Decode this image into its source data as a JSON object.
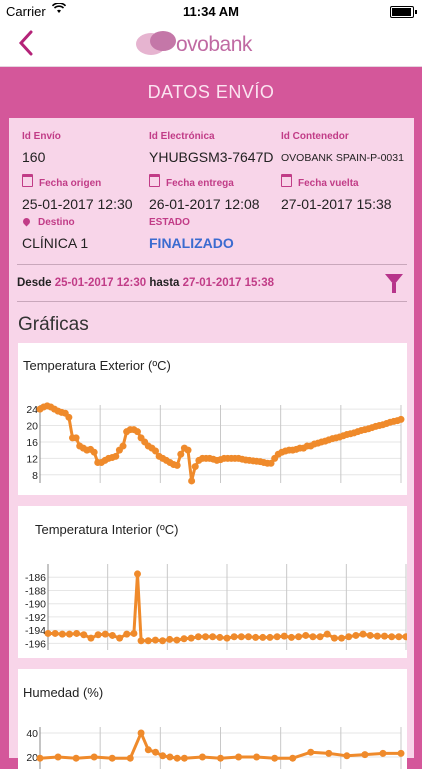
{
  "status_bar": {
    "carrier": "Carrier",
    "wifi_icon": "wifi-icon",
    "time": "11:34 AM",
    "battery_icon": "battery-icon"
  },
  "nav": {
    "back_icon": "chevron-left-icon",
    "back_glyph": "‹",
    "logo_text": "ovobank"
  },
  "page_title": "DATOS ENVÍO",
  "shipment": {
    "id_envio": {
      "label": "Id Envío",
      "value": "160"
    },
    "id_electronica": {
      "label": "Id Electrónica",
      "value": "YHUBGSM3-7647D"
    },
    "id_contenedor": {
      "label": "Id Contenedor",
      "value": "OVOBANK SPAIN-P-0031"
    },
    "fecha_origen": {
      "label": "Fecha origen",
      "value": "25-01-2017 12:30"
    },
    "fecha_entrega": {
      "label": "Fecha entrega",
      "value": "26-01-2017 12:08"
    },
    "fecha_vuelta": {
      "label": "Fecha vuelta",
      "value": "27-01-2017 15:38"
    },
    "destino": {
      "label": "Destino",
      "value": "CLÍNICA 1"
    },
    "estado": {
      "label": "ESTADO",
      "value": "FINALIZADO"
    }
  },
  "range": {
    "desde_label": "Desde",
    "desde": "25-01-2017 12:30",
    "hasta_label": "hasta",
    "hasta": "27-01-2017 15:38",
    "filter_icon": "filter-icon"
  },
  "graficas_title": "Gráficas",
  "colors": {
    "brand": "#d4579a",
    "accent": "#c13c87",
    "status": "#3b6bd0",
    "series": "#ef8a2b"
  },
  "chart_data": [
    {
      "type": "scatter",
      "title": "Temperatura Exterior (ºC)",
      "ylim": [
        6,
        25
      ],
      "yticks": [
        24,
        20,
        16,
        12,
        8
      ],
      "grid": true,
      "x": [
        0,
        1,
        2,
        3,
        4,
        5,
        6,
        7,
        8,
        9,
        10,
        11,
        12,
        13,
        14,
        15,
        16,
        17,
        18,
        19,
        20,
        21,
        22,
        23,
        24,
        25,
        26,
        27,
        28,
        29,
        30,
        31,
        32,
        33,
        34,
        35,
        36,
        37,
        38,
        39,
        40,
        41,
        42,
        43,
        44,
        45,
        46,
        47,
        48,
        49,
        50,
        51,
        52,
        53,
        54,
        55,
        56,
        57,
        58,
        59,
        60,
        61,
        62,
        63,
        64,
        65,
        66,
        67,
        68,
        69,
        70,
        71,
        72,
        73,
        74,
        75,
        76,
        77,
        78,
        79,
        80,
        81,
        82,
        83,
        84,
        85,
        86,
        87,
        88,
        89,
        90,
        91,
        92,
        93,
        94,
        95,
        96,
        97,
        98,
        99,
        100
      ],
      "values": [
        24,
        24.5,
        24.8,
        24.5,
        24,
        23.5,
        23.2,
        23,
        22,
        17,
        17,
        15,
        14.5,
        14,
        14.2,
        13.5,
        11,
        11,
        11.5,
        12,
        12.2,
        12.5,
        14,
        15,
        18.5,
        19,
        19,
        18.5,
        17,
        16,
        15,
        14.5,
        13.8,
        12.5,
        12,
        11.5,
        11,
        10.5,
        10.3,
        13,
        14.5,
        14,
        6.5,
        10,
        11.5,
        12,
        12,
        12,
        11.8,
        11.5,
        11.7,
        12,
        12,
        12,
        12,
        12,
        11.8,
        11.6,
        11.5,
        11.4,
        11.3,
        11.2,
        11,
        10.8,
        10.8,
        12,
        13,
        13.5,
        13.8,
        14,
        14,
        14.2,
        14.5,
        14.5,
        15,
        15,
        15.5,
        15.7,
        16,
        16.2,
        16.5,
        16.8,
        17,
        17.2,
        17.5,
        17.8,
        18,
        18.2,
        18.5,
        18.8,
        19,
        19.2,
        19.5,
        19.8,
        20,
        20.2,
        20.5,
        20.8,
        21,
        21.2,
        21.5
      ]
    },
    {
      "type": "scatter",
      "title": "Temperatura Interior (ºC)",
      "ylim": [
        -197,
        -184
      ],
      "yticks": [
        -186,
        -188,
        -190,
        -192,
        -194,
        -196
      ],
      "grid": true,
      "x": [
        0,
        2,
        4,
        6,
        8,
        10,
        12,
        14,
        16,
        18,
        20,
        22,
        24,
        25,
        26,
        28,
        30,
        32,
        34,
        36,
        38,
        40,
        42,
        44,
        46,
        48,
        50,
        52,
        54,
        56,
        58,
        60,
        62,
        64,
        66,
        68,
        70,
        72,
        74,
        76,
        78,
        80,
        82,
        84,
        86,
        88,
        90,
        92,
        94,
        96,
        98,
        100
      ],
      "values": [
        -194.5,
        -194.5,
        -194.6,
        -194.6,
        -194.5,
        -194.7,
        -195.2,
        -194.7,
        -194.6,
        -194.8,
        -195.2,
        -194.6,
        -194.5,
        -185.5,
        -195.6,
        -195.6,
        -195.5,
        -195.6,
        -195.4,
        -195.5,
        -195.3,
        -195.2,
        -195,
        -195,
        -195,
        -195.1,
        -195.2,
        -195,
        -195,
        -195,
        -195.1,
        -195.1,
        -195.1,
        -195,
        -194.9,
        -195.1,
        -195,
        -194.8,
        -195,
        -195,
        -194.6,
        -195.2,
        -195.2,
        -195,
        -194.8,
        -194.6,
        -194.8,
        -194.9,
        -194.9,
        -195,
        -195,
        -195
      ]
    },
    {
      "type": "scatter",
      "title": "Humedad (%)",
      "ylim": [
        10,
        45
      ],
      "yticks": [
        40,
        20
      ],
      "grid": true,
      "x": [
        0,
        5,
        10,
        15,
        20,
        25,
        28,
        30,
        32,
        34,
        36,
        38,
        40,
        45,
        50,
        55,
        60,
        65,
        70,
        75,
        80,
        85,
        90,
        95,
        100
      ],
      "values": [
        19,
        20,
        19,
        20,
        19,
        19,
        40,
        26,
        24,
        21,
        20,
        19,
        19,
        20,
        19,
        20,
        20,
        19,
        19,
        24,
        23,
        21,
        22,
        23,
        23
      ]
    }
  ]
}
